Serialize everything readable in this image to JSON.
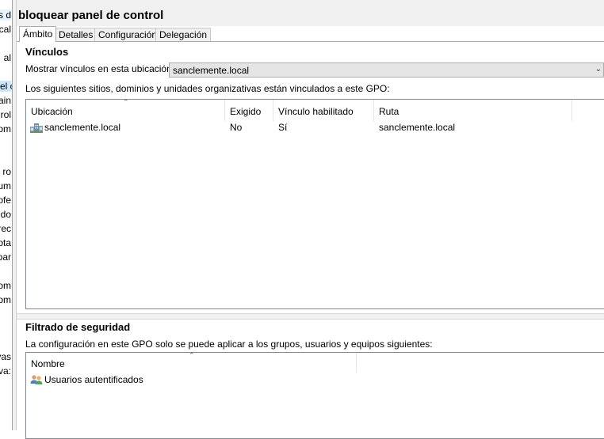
{
  "left_tree": {
    "items": [
      "s d",
      "cal",
      "al",
      "el c",
      "ain",
      "rol",
      "om",
      "ro",
      "um",
      "ofe",
      "do",
      "rec",
      "ota",
      "par",
      "om",
      "om",
      "vas",
      "va:"
    ]
  },
  "gpo": {
    "title": "bloquear panel de control"
  },
  "tabs": [
    "Ámbito",
    "Detalles",
    "Configuración",
    "Delegación"
  ],
  "links": {
    "heading": "Vínculos",
    "location_label": "Mostrar vínculos en esta ubicación:",
    "location_value": "sanclemente.local",
    "description": "Los siguientes sitios, dominios y unidades organizativas están vinculados a este GPO:",
    "columns": [
      "Ubicación",
      "Exigido",
      "Vínculo habilitado",
      "Ruta"
    ],
    "rows": [
      {
        "location": "sanclemente.local",
        "enforced": "No",
        "enabled": "Sí",
        "path": "sanclemente.local"
      }
    ]
  },
  "security": {
    "heading": "Filtrado de seguridad",
    "description": "La configuración en este GPO solo se puede aplicar a los grupos, usuarios y equipos siguientes:",
    "columns": [
      "Nombre"
    ],
    "rows": [
      "Usuarios autentificados"
    ]
  },
  "colors": {
    "selection": "#cce8ff",
    "panel": "#f0f0f0",
    "border": "#828790"
  },
  "icons": {
    "domain": "domain-icon",
    "users": "users-group-icon",
    "dropdown": "chevron-down-icon",
    "sort": "sort-up-icon"
  }
}
